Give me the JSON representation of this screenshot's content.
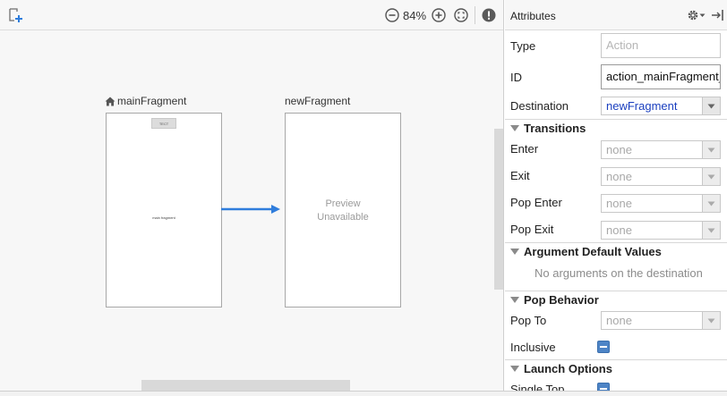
{
  "editor": {
    "zoom_level": "84%",
    "destinations": [
      {
        "name": "mainFragment",
        "is_start": true,
        "toolbar_text": "ТЕСТ",
        "center_text": "main fragment"
      },
      {
        "name": "newFragment",
        "is_start": false,
        "preview_text": "Preview\nUnavailable"
      }
    ],
    "action": {
      "from": "mainFragment",
      "to": "newFragment",
      "color": "#2f7ddc"
    }
  },
  "panel": {
    "title": "Attributes",
    "fields": {
      "type": {
        "label": "Type",
        "placeholder": "Action",
        "value": ""
      },
      "id": {
        "label": "ID",
        "value": "action_mainFragment_"
      },
      "destination": {
        "label": "Destination",
        "value": "newFragment"
      }
    },
    "transitions": {
      "heading": "Transitions",
      "items": [
        {
          "label": "Enter",
          "value": "none"
        },
        {
          "label": "Exit",
          "value": "none"
        },
        {
          "label": "Pop Enter",
          "value": "none"
        },
        {
          "label": "Pop Exit",
          "value": "none"
        }
      ]
    },
    "arguments": {
      "heading": "Argument Default Values",
      "empty_text": "No arguments on the destination"
    },
    "pop_behavior": {
      "heading": "Pop Behavior",
      "pop_to": {
        "label": "Pop To",
        "value": "none"
      },
      "inclusive": {
        "label": "Inclusive",
        "checked": "indeterminate"
      }
    },
    "launch_options": {
      "heading": "Launch Options",
      "single_top": {
        "label": "Single Top"
      }
    }
  },
  "colors": {
    "accent": "#2f7ddc",
    "checkbox": "#4d84c6",
    "destination_text": "#1a3fbf"
  },
  "icons": [
    "new-destination-icon",
    "zoom-out-icon",
    "zoom-in-icon",
    "zoom-to-fit-icon",
    "issues-icon",
    "home-icon",
    "gear-icon",
    "hide-panel-icon",
    "dropdown-arrow-icon"
  ]
}
